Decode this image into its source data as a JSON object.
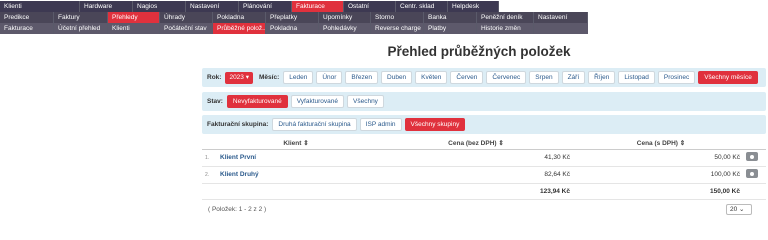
{
  "menu": {
    "row1": [
      "Klienti",
      "Hardware",
      "Nagios",
      "Nastavení",
      "Plánování",
      "Fakturace",
      "Ostatní",
      "Centr. sklad",
      "Helpdesk"
    ],
    "row2": [
      "Predikce",
      "Faktury",
      "Přehledy",
      "Úhrady",
      "Pokladna",
      "Přeplatky",
      "Upomínky",
      "Storno",
      "Banka",
      "Peněžní deník",
      "Nastavení"
    ],
    "row3": [
      "Fakturace",
      "Účetní přehled",
      "Klienti",
      "Počáteční stav",
      "Průběžné polož...",
      "Pokladna",
      "Pohledávky",
      "Reverse charge",
      "Platby",
      "Historie změn"
    ]
  },
  "page_title": "Přehled průběžných položek",
  "filters": {
    "year_label": "Rok:",
    "year_value": "2023",
    "month_label": "Měsíc:",
    "months": [
      "Leden",
      "Únor",
      "Březen",
      "Duben",
      "Květen",
      "Červen",
      "Červenec",
      "Srpen",
      "Září",
      "Říjen",
      "Listopad",
      "Prosinec",
      "Všechny měsíce"
    ],
    "state_label": "Stav:",
    "states": [
      "Nevyfakturované",
      "Vyfakturované",
      "Všechny"
    ],
    "group_label": "Fakturační skupina:",
    "groups": [
      "Druhá fakturační skupina",
      "ISP admin",
      "Všechny skupiny"
    ]
  },
  "table": {
    "headers": [
      "Klient ⇕",
      "Cena (bez DPH) ⇕",
      "Cena (s DPH) ⇕"
    ],
    "rows": [
      {
        "num": "1.",
        "client": "Klient První",
        "net": "41,30 Kč",
        "gross": "50,00 Kč"
      },
      {
        "num": "2.",
        "client": "Klient Druhý",
        "net": "82,64 Kč",
        "gross": "100,00 Kč"
      }
    ],
    "total_net": "123,94 Kč",
    "total_gross": "150,00 Kč"
  },
  "footer": {
    "info": "( Položek: 1 - 2 z 2 )",
    "page_size": "20 ⌄"
  },
  "colors": {
    "accent": "#e0313d",
    "filter_bg": "#dcedf5",
    "menu_dark": "#3d3952"
  }
}
